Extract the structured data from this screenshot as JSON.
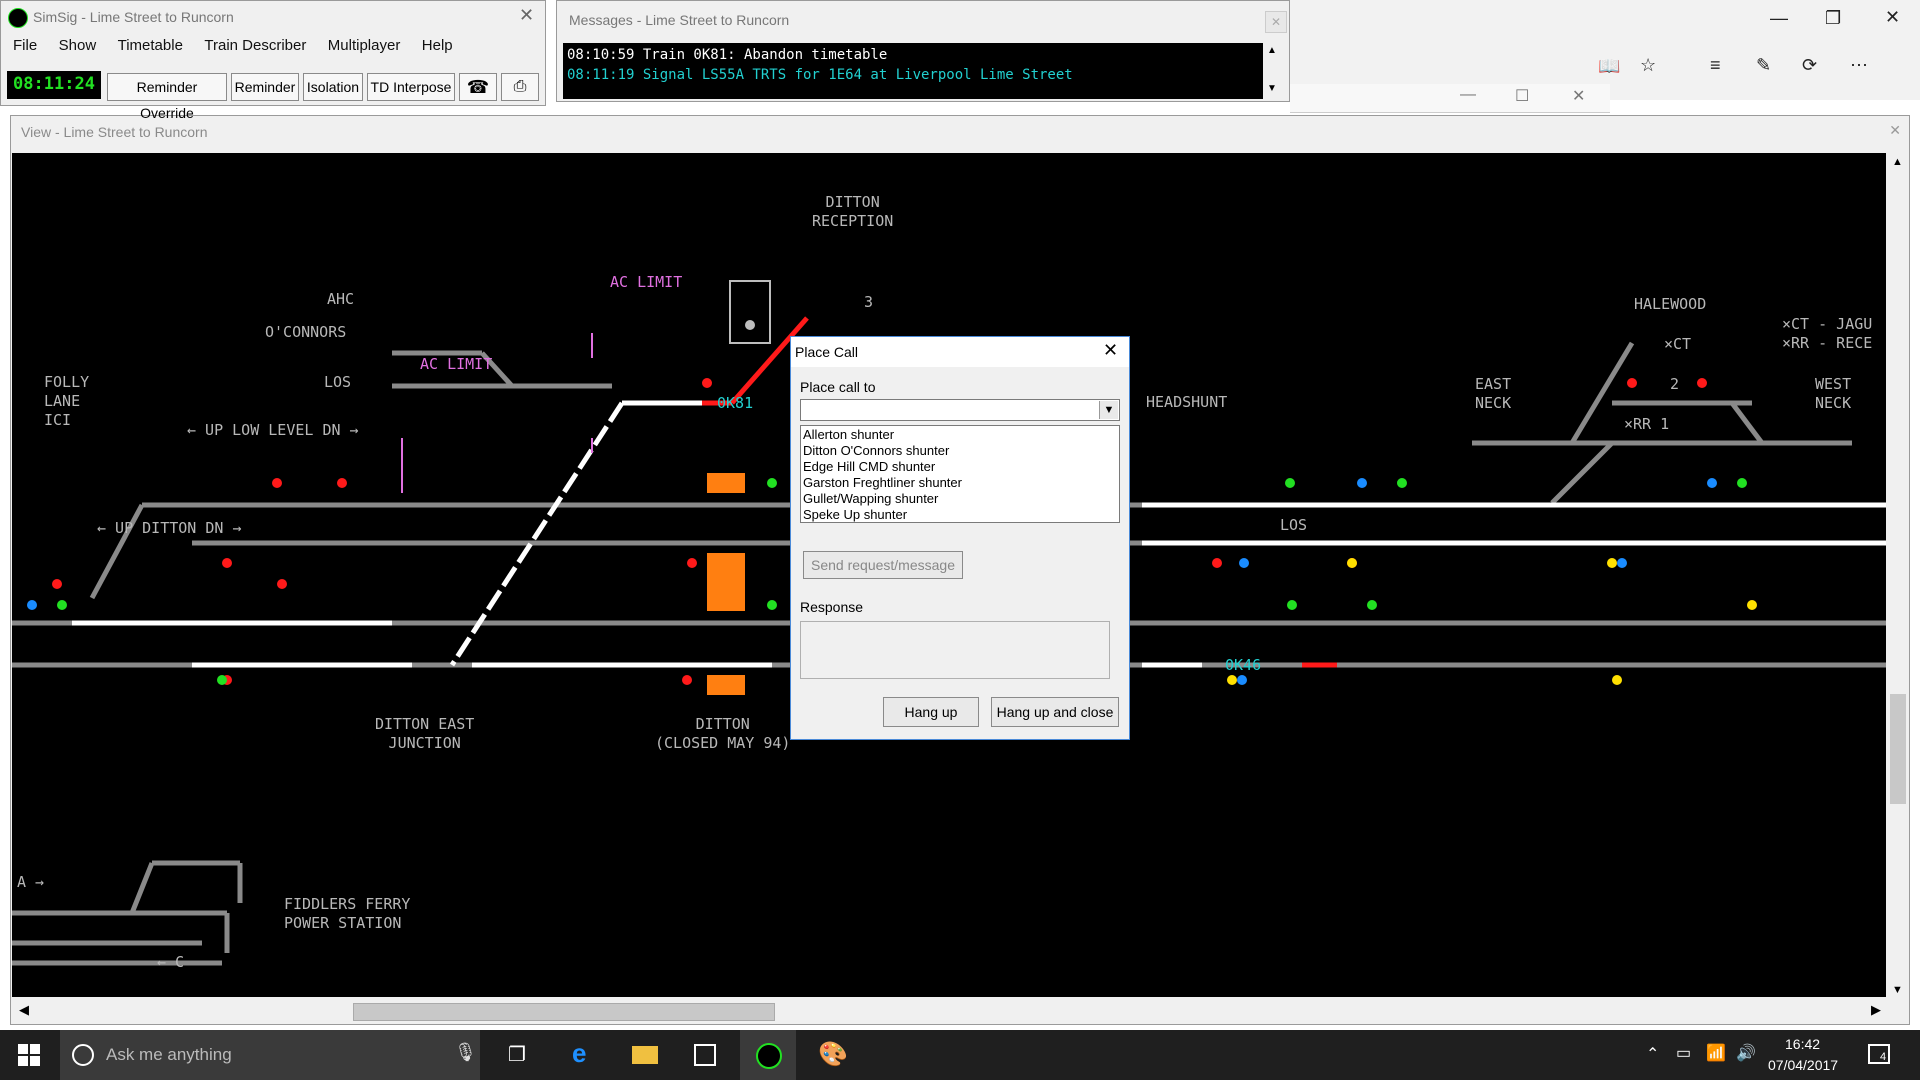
{
  "main_window": {
    "title": "SimSig - Lime Street to Runcorn",
    "menu": [
      "File",
      "Show",
      "Timetable",
      "Train Describer",
      "Multiplayer",
      "Help"
    ],
    "clock": "08:11:24",
    "toolbar": [
      "Reminder Override",
      "Reminder",
      "Isolation",
      "TD Interpose"
    ]
  },
  "messages_window": {
    "title": "Messages - Lime Street to Runcorn",
    "lines": [
      {
        "text": "08:10:59 Train 0K81: Abandon timetable",
        "color": "#ffffff"
      },
      {
        "text": "08:11:19 Signal LS55A TRTS for 1E64 at Liverpool Lime Street",
        "color": "#22d0d0"
      }
    ]
  },
  "view_window": {
    "title": "View - Lime Street to Runcorn"
  },
  "panel": {
    "labels": {
      "ditton_reception": "DITTON\nRECEPTION",
      "ahc": "AHC",
      "oconnors": "O'CONNORS",
      "ac_limit_1": "AC LIMIT",
      "ac_limit_2": "AC LIMIT",
      "folly_lane": "FOLLY\nLANE\nICI",
      "los_1": "LOS",
      "los_2": "LOS",
      "up_low_level": "← UP LOW LEVEL DN →",
      "up_ditton": "← UP DITTON DN →",
      "ditton_east": "DITTON EAST\nJUNCTION",
      "ditton": "DITTON\n(CLOSED MAY 94)",
      "headshunt": "HEADSHUNT",
      "east_neck": "EAST\nNECK",
      "halewood": "HALEWOOD",
      "xct": "×CT",
      "xrr1": "×RR 1",
      "xct_jagu": "×CT - JAGU\n×RR - RECE",
      "west_neck": "WEST\nNECK",
      "fiddlers_ferry": "FIDDLERS FERRY\nPOWER STATION",
      "a_arrow": "A →",
      "c_arrow": "← C",
      "num_3": "3",
      "num_2": "2",
      "num_1": "1"
    },
    "train_ids": [
      "0K81",
      "0K46"
    ]
  },
  "dialog": {
    "title": "Place Call",
    "place_call_label": "Place call to",
    "options": [
      "Allerton shunter",
      "Ditton O'Connors shunter",
      "Edge Hill CMD shunter",
      "Garston Freghtliner shunter",
      "Gullet/Wapping shunter",
      "Speke Up shunter"
    ],
    "send_button": "Send request/message",
    "response_label": "Response",
    "hang_up": "Hang up",
    "hang_up_close": "Hang up and close"
  },
  "taskbar": {
    "search_placeholder": "Ask me anything",
    "time": "16:42",
    "date": "07/04/2017",
    "notifications": "4"
  }
}
